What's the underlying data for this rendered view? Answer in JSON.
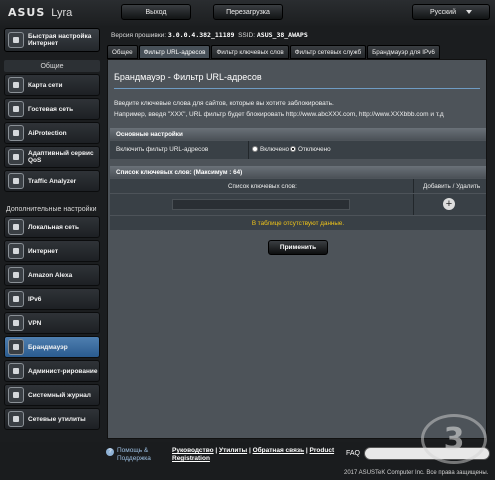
{
  "header": {
    "brand": "ASUS",
    "model": "Lyra",
    "logout_label": "Выход",
    "reboot_label": "Перезагрузка",
    "language": "Русский"
  },
  "sidebar": {
    "quick_setup": "Быстрая настройка Интернет",
    "general_title": "Общие",
    "general_items": [
      {
        "label": "Карта сети",
        "icon": "network-map-icon"
      },
      {
        "label": "Гостевая сеть",
        "icon": "guest-network-icon"
      },
      {
        "label": "AiProtection",
        "icon": "aiprotection-icon"
      },
      {
        "label": "Адаптивный сервис QoS",
        "icon": "qos-icon"
      },
      {
        "label": "Traffic Analyzer",
        "icon": "traffic-analyzer-icon"
      }
    ],
    "advanced_title": "Дополнительные настройки",
    "advanced_items": [
      {
        "label": "Локальная сеть",
        "icon": "lan-icon"
      },
      {
        "label": "Интернет",
        "icon": "wan-icon"
      },
      {
        "label": "Amazon Alexa",
        "icon": "alexa-icon"
      },
      {
        "label": "IPv6",
        "icon": "ipv6-icon"
      },
      {
        "label": "VPN",
        "icon": "vpn-icon"
      },
      {
        "label": "Брандмауэр",
        "icon": "firewall-icon",
        "active": true
      },
      {
        "label": "Админист-рирование",
        "icon": "admin-icon"
      },
      {
        "label": "Системный журнал",
        "icon": "syslog-icon"
      },
      {
        "label": "Сетевые утилиты",
        "icon": "network-tools-icon"
      }
    ]
  },
  "status": {
    "firmware_label": "Версия прошивки:",
    "firmware": "3.0.0.4.382_11189",
    "ssid_label": "SSID:",
    "ssid": "ASUS_38_AWAPS"
  },
  "tabs": [
    {
      "label": "Общее",
      "active": false
    },
    {
      "label": "Фильтр URL-адресов",
      "active": true
    },
    {
      "label": "Фильтр ключевых слов",
      "active": false
    },
    {
      "label": "Фильтр сетевых служб",
      "active": false
    },
    {
      "label": "Брандмауэр для IPv6",
      "active": false
    }
  ],
  "main": {
    "title": "Брандмауэр - Фильтр URL-адресов",
    "desc_line1": "Введите ключевые слова для сайтов, которые вы хотите заблокировать.",
    "desc_line2": "Например, введя \"XXX\", URL фильтр будет блокировать http://www.abcXXX.com, http://www.XXXbbb.com и т.д",
    "basic_header": "Основные настройки",
    "enable_label": "Включить фильтр URL-адресов",
    "radio_on": "Включено",
    "radio_off": "Отключено",
    "list_header": "Список ключевых слов: (Максимум : 64)",
    "col_keyword": "Список ключевых слов:",
    "col_action": "Добавить / Удалить",
    "empty_text": "В таблице отсутствуют данные.",
    "apply_label": "Применить"
  },
  "footer": {
    "help_label": "Помощь & Поддержка",
    "link_manual": "Руководство",
    "link_utils": "Утилиты",
    "link_feedback": "Обратная связь",
    "link_product": "Product",
    "link_registration": "Registration",
    "faq": "FAQ",
    "copyright": "2017 ASUSTeK Computer Inc. Все права защищены."
  },
  "watermark": "3"
}
